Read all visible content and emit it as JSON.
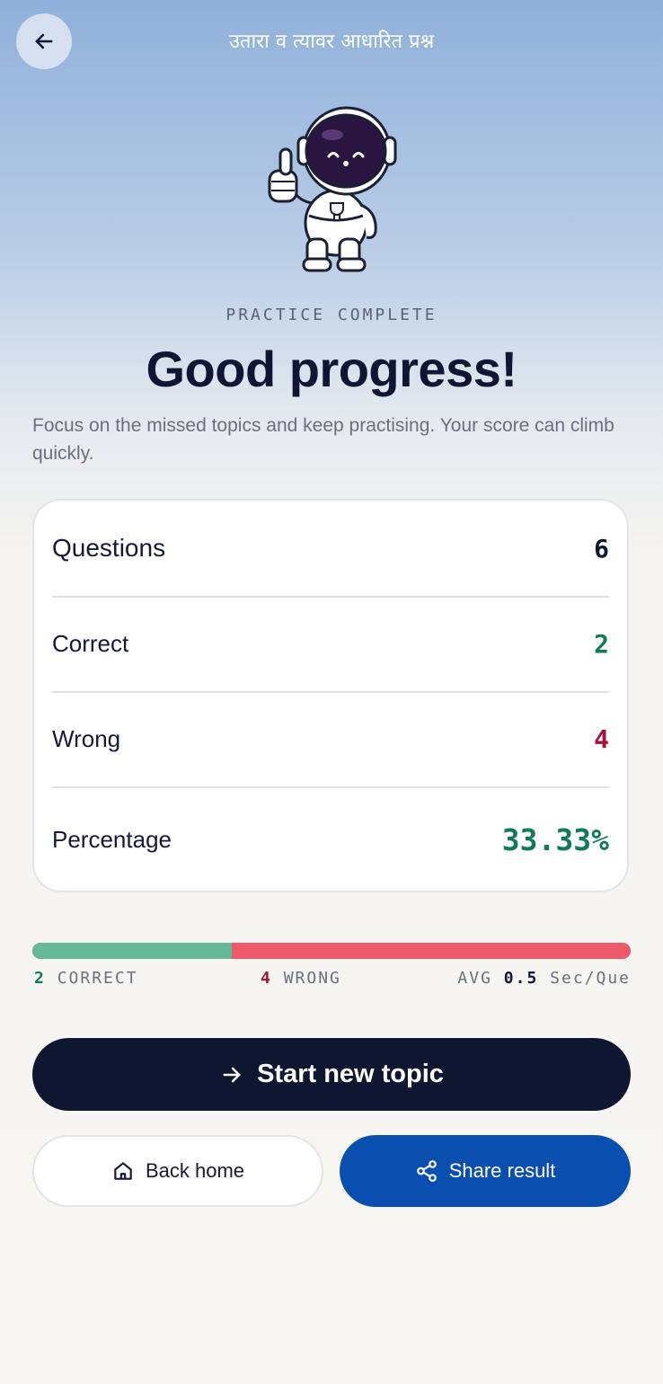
{
  "header": {
    "title": "उतारा व त्यावर आधारित प्रश्न",
    "back_icon": "arrow-left-icon"
  },
  "hero": {
    "illustration": "astronaut-thumbs-up",
    "eyebrow": "PRACTICE COMPLETE",
    "headline": "Good progress!",
    "subtext": "Focus on the missed topics and keep practising. Your score can climb quickly."
  },
  "stats": {
    "rows": [
      {
        "label": "Questions",
        "value": "6"
      },
      {
        "label": "Correct",
        "value": "2"
      },
      {
        "label": "Wrong",
        "value": "4"
      },
      {
        "label": "Percentage",
        "value": "33.33%"
      }
    ]
  },
  "progress": {
    "correct_fraction": 0.3333,
    "correct_count": "2",
    "correct_label": "CORRECT",
    "wrong_count": "4",
    "wrong_label": "WRONG",
    "avg_prefix": "AVG",
    "avg_value": "0.5",
    "avg_unit": "Sec/Que"
  },
  "actions": {
    "start_label": "Start new topic",
    "home_label": "Back home",
    "share_label": "Share result"
  },
  "colors": {
    "navy": "#0e1632",
    "correct_green": "#127a5c",
    "wrong_red": "#a3143a",
    "bar_green": "#66b999",
    "bar_red": "#ee5a6a",
    "share_blue": "#0a4fb0"
  }
}
